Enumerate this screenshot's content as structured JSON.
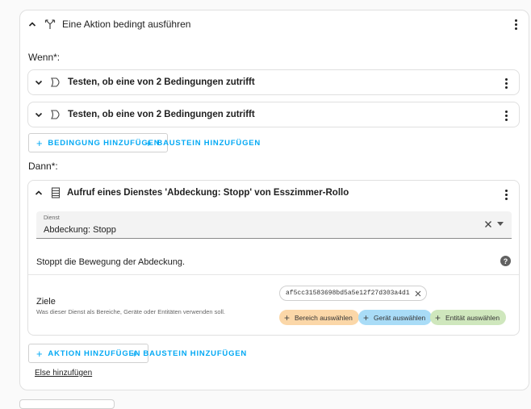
{
  "block": {
    "title": "Eine Aktion bedingt ausführen",
    "if_label": "Wenn*:",
    "then_label": "Dann*:",
    "else_link": "Else hinzufügen"
  },
  "conditions": [
    {
      "title": "Testen, ob eine von 2 Bedingungen zutrifft"
    },
    {
      "title": "Testen, ob eine von 2 Bedingungen zutrifft"
    }
  ],
  "condition_buttons": {
    "add_condition": "Bedingung hinzufügen",
    "add_building_block": "Baustein hinzufügen"
  },
  "action": {
    "title": "Aufruf eines Dienstes 'Abdeckung: Stopp' von Esszimmer-Rollo",
    "service_label": "Dienst",
    "service_value": "Abdeckung: Stopp",
    "description": "Stoppt die Bewegung der Abdeckung.",
    "targets_title": "Ziele",
    "targets_help": "Was dieser Dienst als Bereiche, Geräte oder Entitäten verwenden soll.",
    "entity_chip": "af5cc31583698bd5a5e12f27d303a4d1",
    "chip_area": "Bereich auswählen",
    "chip_device": "Gerät auswählen",
    "chip_entity": "Entität auswählen"
  },
  "action_buttons": {
    "add_action": "Aktion hinzufügen",
    "add_building_block": "Baustein hinzufügen"
  },
  "colors": {
    "accent": "#03a9f4",
    "chip_area": "#fbd7a8",
    "chip_device": "#a9dcf7",
    "chip_entity": "#cfe7bd"
  }
}
